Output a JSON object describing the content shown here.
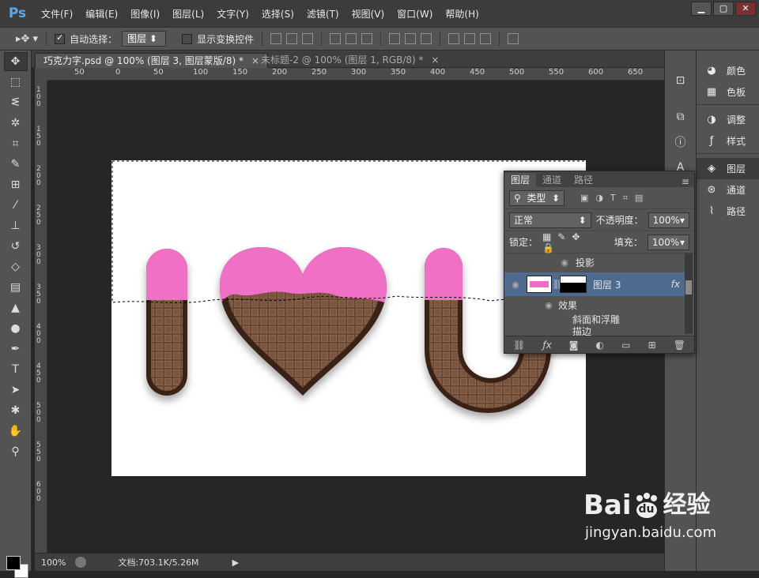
{
  "app": {
    "logo": "Ps"
  },
  "menu": [
    "文件(F)",
    "编辑(E)",
    "图像(I)",
    "图层(L)",
    "文字(Y)",
    "选择(S)",
    "滤镜(T)",
    "视图(V)",
    "窗口(W)",
    "帮助(H)"
  ],
  "window_controls": [
    "▁",
    "▢",
    "✕"
  ],
  "options": {
    "auto_select_label": "自动选择：",
    "auto_select_value": "图层",
    "show_transform_label": "显示变换控件"
  },
  "tabs": [
    {
      "label": "巧克力字.psd @ 100% (图层 3, 图层蒙版/8) *",
      "close": "×"
    },
    {
      "label": "未标题-2 @ 100% (图层 1, RGB/8) *",
      "close": "×"
    }
  ],
  "ruler_h": [
    "50",
    "0",
    "50",
    "100",
    "150",
    "200",
    "250",
    "300",
    "350",
    "400",
    "450",
    "500",
    "550",
    "600",
    "650"
  ],
  "ruler_v": [
    "100",
    "150",
    "200",
    "250",
    "300",
    "350",
    "400",
    "450",
    "500",
    "550",
    "600"
  ],
  "status": {
    "zoom": "100%",
    "doc_info": "文档:703.1K/5.26M",
    "arrow": "▶"
  },
  "right_panel": [
    "颜色",
    "色板",
    "调整",
    "样式",
    "图层",
    "通道",
    "路径"
  ],
  "layers_panel": {
    "tabs": [
      "图层",
      "通道",
      "路径"
    ],
    "filter_kind": "类型",
    "blend_mode": "正常",
    "opacity_label": "不透明度：",
    "opacity_value": "100%",
    "lock_label": "锁定：",
    "fill_label": "填充：",
    "fill_value": "100%",
    "layers": [
      {
        "name": "投影"
      },
      {
        "name": "图层 3",
        "fx": "fx"
      },
      {
        "name": "效果"
      },
      {
        "name": "斜面和浮雕"
      },
      {
        "name": "描边"
      }
    ]
  },
  "watermark": {
    "brand": "Bai",
    "paw_text": "du",
    "cn": "经验",
    "url": "jingyan.baidu.com"
  },
  "colors": {
    "pink": "#f06fc6",
    "chocolate": "#5a3a28",
    "selection": "#4e6a8f"
  }
}
